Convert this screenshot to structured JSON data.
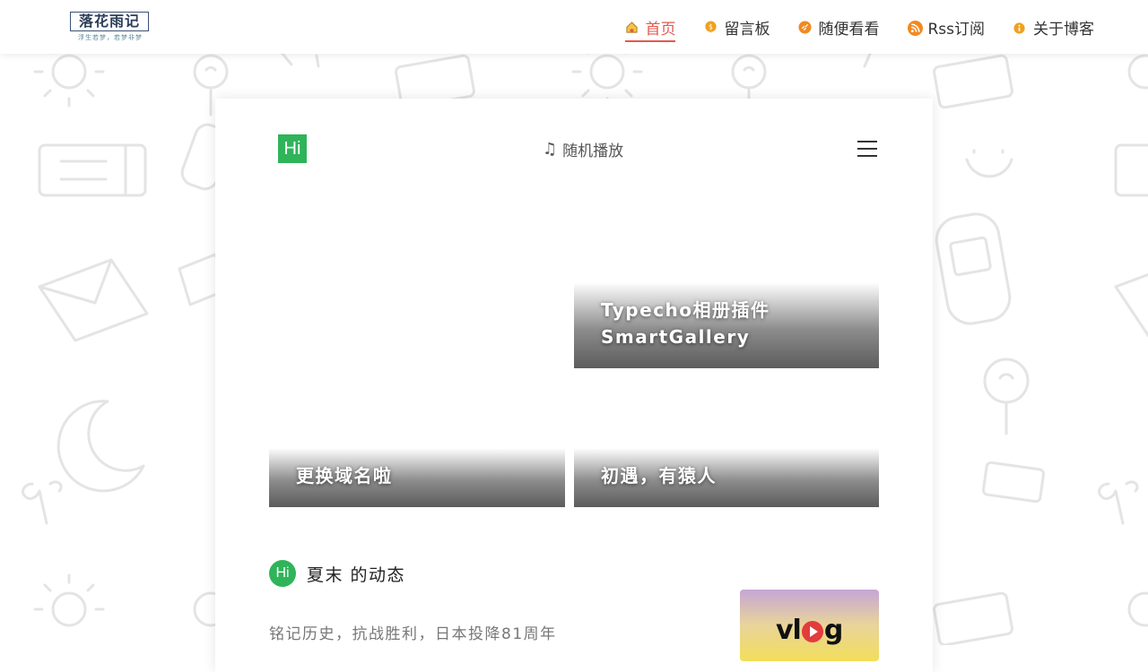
{
  "navbar": {
    "logo_text": "落花雨记",
    "logo_subtitle": "浮生若梦，若梦非梦",
    "items": [
      {
        "label": "首页",
        "icon": "home-icon",
        "color": "#e2594f",
        "active": true
      },
      {
        "label": "留言板",
        "icon": "message-icon",
        "color": "#f0a020",
        "active": false
      },
      {
        "label": "随便看看",
        "icon": "link-icon",
        "color": "#f08a20",
        "active": false
      },
      {
        "label": "Rss订阅",
        "icon": "rss-icon",
        "color": "#f08a20",
        "active": false
      },
      {
        "label": "关于博客",
        "icon": "info-icon",
        "color": "#f0a020",
        "active": false
      }
    ]
  },
  "card": {
    "logo_text": "Hi",
    "music_label": "随机播放",
    "posts": [
      {
        "title": "Typecho相册插件SmartGallery"
      },
      {
        "title": "更换域名啦"
      },
      {
        "title": "初遇，有猿人"
      }
    ],
    "dynamic": {
      "avatar_text": "Hi",
      "title": "夏末 的动态",
      "text": "铭记历史，抗战胜利，日本投降81周年",
      "thumb_text": "vlog"
    }
  },
  "colors": {
    "accent": "#e2594f",
    "brand_green": "#2fb45a"
  }
}
